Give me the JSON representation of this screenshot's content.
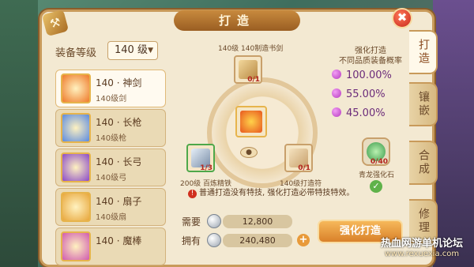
{
  "dialog": {
    "title": "打造",
    "close_label": "✖"
  },
  "level": {
    "label": "装备等级",
    "value": "140 级",
    "arrow": "▼"
  },
  "items": [
    {
      "name": "140 · 神剑",
      "sub": "140级剑",
      "color": "#ef7a2a",
      "selected": true
    },
    {
      "name": "140 · 长枪",
      "sub": "140级枪",
      "color": "#5a8ae0",
      "selected": false
    },
    {
      "name": "140 · 长弓",
      "sub": "140级弓",
      "color": "#8a4ac8",
      "selected": false
    },
    {
      "name": "140 · 扇子",
      "sub": "140级扇",
      "color": "#e8a63a",
      "selected": false
    },
    {
      "name": "140 · 魔棒",
      "sub": "",
      "color": "#d05ab0",
      "selected": false
    }
  ],
  "forge": {
    "top_slot_label": "140级 140制造书剑",
    "top_slot_count": "0/1",
    "left_slot_label": "200级 百炼精铁",
    "left_slot_count": "1/3",
    "right_slot_label": "140级打造符",
    "right_slot_count": "0/1",
    "stone_label": "青龙强化石",
    "stone_count": "0/40"
  },
  "rates": {
    "heading": "强化打造\n不同品质装备概率",
    "values": [
      "100.00%",
      "55.00%",
      "45.00%"
    ]
  },
  "note": {
    "text": "普通打造没有特技, 强化打造必带特技特效。",
    "icon": "!"
  },
  "costs": {
    "need_label": "需要",
    "need_value": "12,800",
    "have_label": "拥有",
    "have_value": "240,480",
    "plus_label": "+"
  },
  "forge_button": "强化打造",
  "tabs": [
    "打造",
    "镶嵌",
    "合成",
    "修理"
  ],
  "watermark": {
    "line1": "热血网游单机论坛",
    "line2": "www.rexuexia.com"
  }
}
